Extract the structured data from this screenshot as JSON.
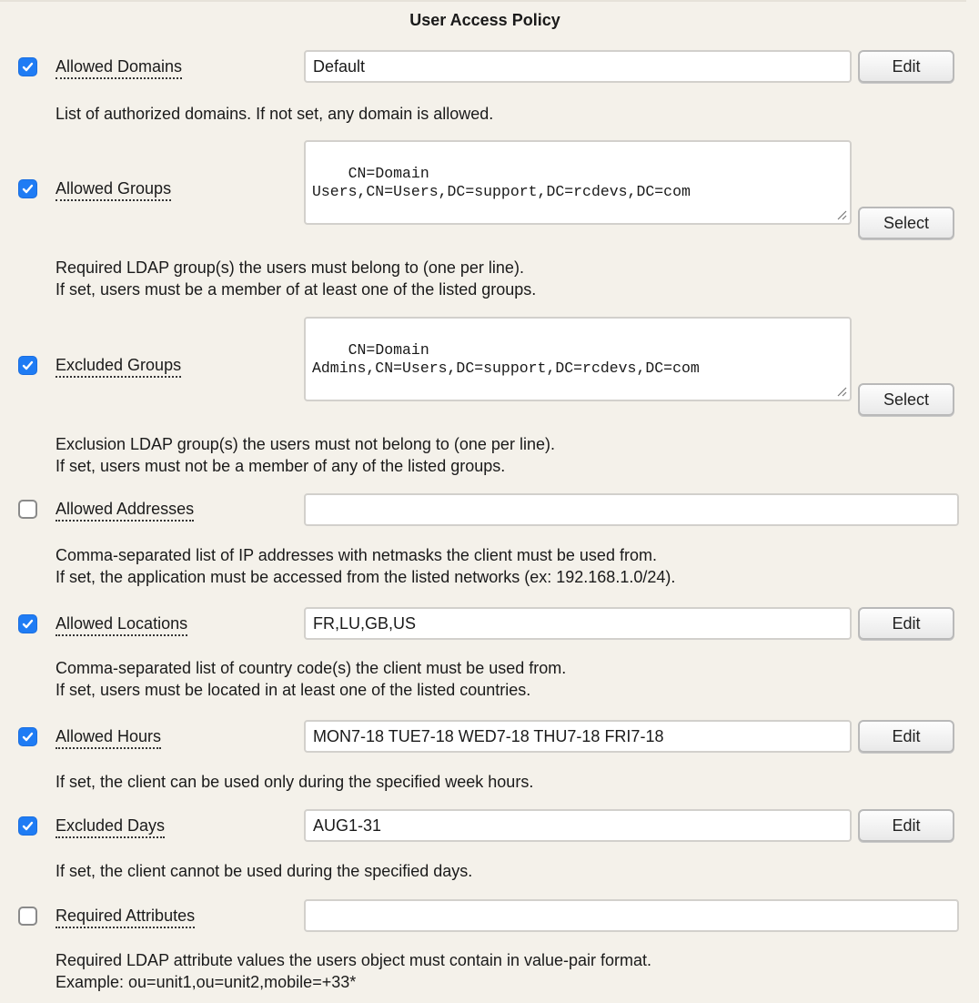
{
  "title": "User Access Policy",
  "fields": [
    {
      "label": "Allowed Domains",
      "checked": true,
      "value": "Default",
      "button": "Edit",
      "description": [
        "List of authorized domains. If not set, any domain is allowed."
      ]
    },
    {
      "label": "Allowed Groups",
      "checked": true,
      "value": "CN=Domain\nUsers,CN=Users,DC=support,DC=rcdevs,DC=com",
      "button": "Select",
      "description": [
        "Required LDAP group(s) the users must belong to (one per line).",
        "If set, users must be a member of at least one of the listed groups."
      ]
    },
    {
      "label": "Excluded Groups",
      "checked": true,
      "value": "CN=Domain\nAdmins,CN=Users,DC=support,DC=rcdevs,DC=com",
      "button": "Select",
      "description": [
        "Exclusion LDAP group(s) the users must not belong to (one per line).",
        "If set, users must not be a member of any of the listed groups."
      ]
    },
    {
      "label": "Allowed Addresses",
      "checked": false,
      "value": "",
      "description": [
        "Comma-separated list of IP addresses with netmasks the client must be used from.",
        "If set, the application must be accessed from the listed networks (ex: 192.168.1.0/24)."
      ]
    },
    {
      "label": "Allowed Locations",
      "checked": true,
      "value": "FR,LU,GB,US",
      "button": "Edit",
      "description": [
        "Comma-separated list of country code(s) the client must be used from.",
        "If set, users must be located in at least one of the listed countries."
      ]
    },
    {
      "label": "Allowed Hours",
      "checked": true,
      "value": "MON7-18 TUE7-18 WED7-18 THU7-18 FRI7-18",
      "button": "Edit",
      "description": [
        "If set, the client can be used only during the specified week hours."
      ]
    },
    {
      "label": "Excluded Days",
      "checked": true,
      "value": "AUG1-31",
      "button": "Edit",
      "description": [
        "If set, the client cannot be used during the specified days."
      ]
    },
    {
      "label": "Required Attributes",
      "checked": false,
      "value": "",
      "description": [
        "Required LDAP attribute values the users object must contain in value-pair format.",
        "Example: ou=unit1,ou=unit2,mobile=+33*"
      ]
    }
  ]
}
